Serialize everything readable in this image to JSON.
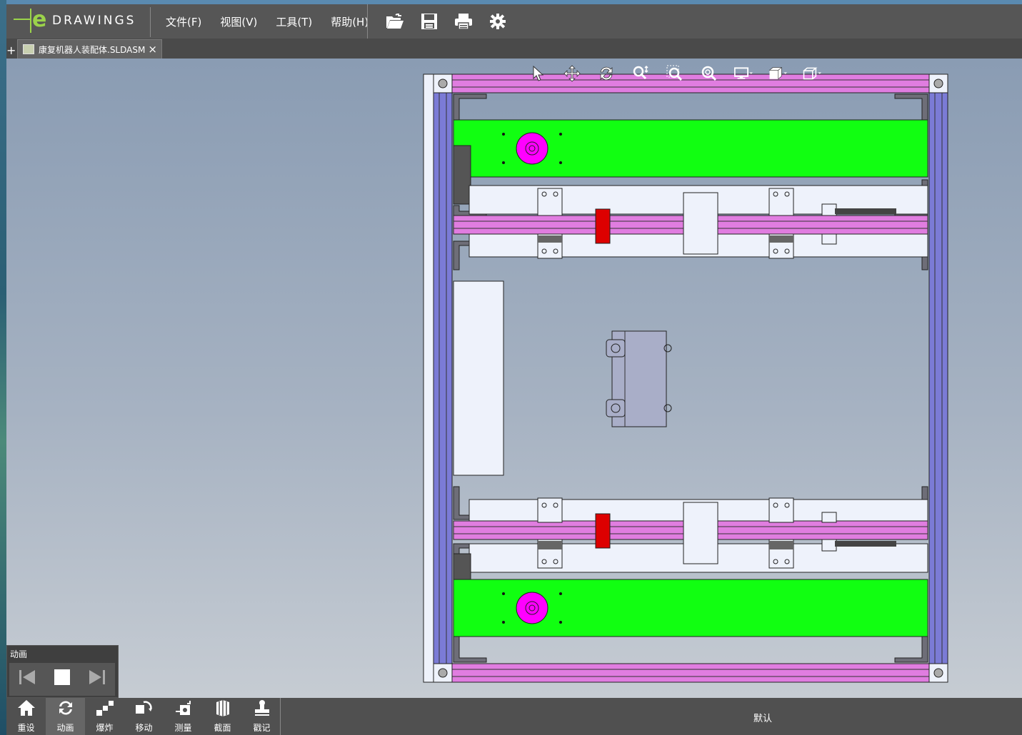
{
  "app": {
    "logo_e": "e",
    "logo_word": "DRAWINGS",
    "menu": [
      {
        "label": "文件(F)"
      },
      {
        "label": "视图(V)"
      },
      {
        "label": "工具(T)"
      },
      {
        "label": "帮助(H)"
      }
    ],
    "toolbar_icons": [
      "open-icon",
      "save-icon",
      "print-icon",
      "settings-icon"
    ]
  },
  "tabs": {
    "plus": "+",
    "active": {
      "label": "康复机器人装配体.SLDASM",
      "close": "×"
    }
  },
  "viewport_tools": [
    "select-icon",
    "pan-icon",
    "rotate-icon",
    "zoom-icon",
    "zoom-to-area-icon",
    "zoom-to-fit-icon",
    "display-style-icon",
    "view-orientation-icon",
    "cube-view-icon"
  ],
  "animation_panel": {
    "title": "动画",
    "controls": [
      "previous-icon",
      "stop-icon",
      "next-icon"
    ]
  },
  "bottom_toolbar": {
    "buttons": [
      {
        "label": "重设",
        "icon": "home-icon"
      },
      {
        "label": "动画",
        "icon": "animate-icon"
      },
      {
        "label": "爆炸",
        "icon": "explode-icon"
      },
      {
        "label": "移动",
        "icon": "move-icon"
      },
      {
        "label": "测量",
        "icon": "measure-icon"
      },
      {
        "label": "截面",
        "icon": "section-icon"
      },
      {
        "label": "戳记",
        "icon": "stamp-icon"
      }
    ],
    "configuration": "默认"
  },
  "colors": {
    "frame_purple": "#7b7bd6",
    "rail_magenta": "#e07de0",
    "plate_green": "#11ff11",
    "marker_red": "#dd0000",
    "part_white": "#eef2fb",
    "block_grey": "#a9aec8"
  }
}
